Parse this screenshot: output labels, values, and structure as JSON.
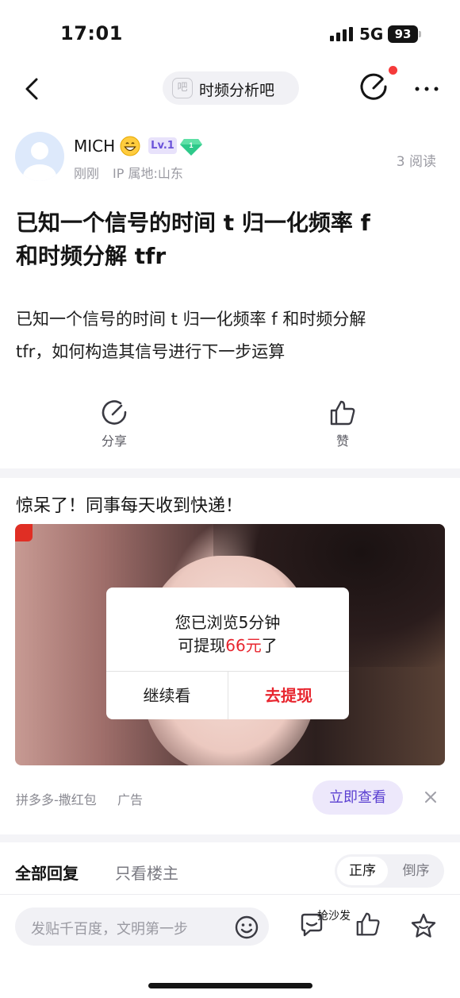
{
  "status_bar": {
    "time": "17:01",
    "network": "5G",
    "battery": "93"
  },
  "nav": {
    "forum_icon_char": "吧",
    "forum_name": "时频分析吧",
    "has_notification_dot": true,
    "accent_color": "#f53a3a"
  },
  "author": {
    "name": "MICH",
    "level": "Lv.1",
    "badge_number": "1",
    "time": "刚刚",
    "ip_location": "IP 属地:山东",
    "read_count": "3 阅读"
  },
  "post": {
    "title_lines": [
      "已知一个信号的时间 t 归一化频率 f",
      "和时频分解 tfr"
    ],
    "body_lines": [
      "已知一个信号的时间 t 归一化频率 f 和时频分解",
      "tfr，如何构造其信号进行下一步运算"
    ]
  },
  "actions": {
    "share_label": "分享",
    "like_label": "赞"
  },
  "ad": {
    "title": "惊呆了！同事每天收到快递！",
    "modal_line1": "您已浏览5分钟",
    "modal_line2_prefix": "可提现",
    "modal_amount": "66元",
    "modal_line2_suffix": "了",
    "continue_label": "继续看",
    "withdraw_label": "去提现",
    "source": "拼多多-撒红包",
    "tag": "广告",
    "cta_label": "立即查看",
    "highlight_color": "#e8262f"
  },
  "replies": {
    "all_label": "全部回复",
    "owner_only_label": "只看楼主",
    "sort_asc": "正序",
    "sort_desc": "倒序",
    "active_sort": "正序"
  },
  "bottom_bar": {
    "placeholder": "发贴千百度，文明第一步",
    "sofa_label": "抢沙发"
  }
}
